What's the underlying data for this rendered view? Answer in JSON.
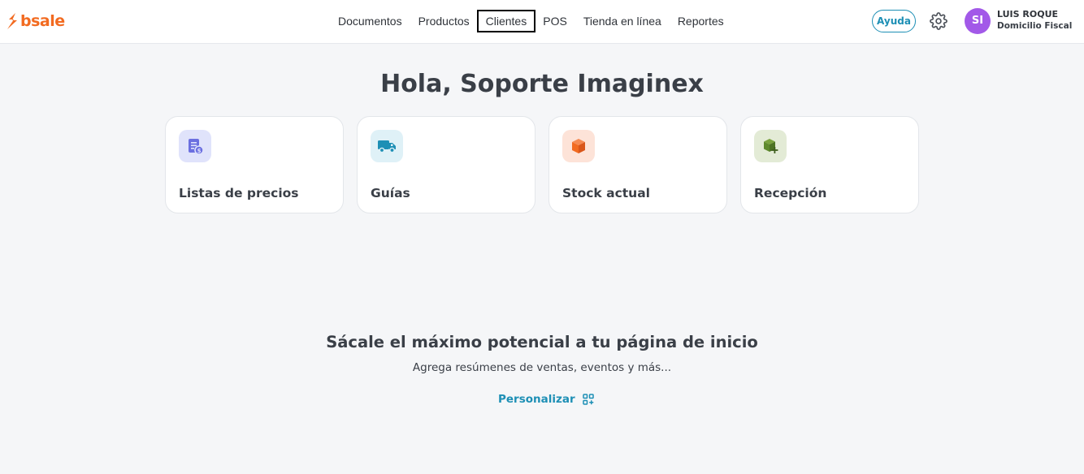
{
  "brand": {
    "name": "bsale",
    "color": "#f26b21"
  },
  "nav": {
    "items": [
      {
        "label": "Documentos"
      },
      {
        "label": "Productos"
      },
      {
        "label": "Clientes"
      },
      {
        "label": "POS"
      },
      {
        "label": "Tienda en línea"
      },
      {
        "label": "Reportes"
      }
    ]
  },
  "header": {
    "help_label": "Ayuda",
    "settings_icon": "gear-icon",
    "user": {
      "initials": "SI",
      "name": "LUIS ROQUE",
      "branch": "Domicilio Fiscal",
      "avatar_color": "#a259e8"
    }
  },
  "main": {
    "greeting": "Hola, Soporte Imaginex",
    "shortcuts": [
      {
        "label": "Listas de precios",
        "icon": "price-list-icon",
        "icon_bg": "#e0e3fb",
        "icon_color": "#6b6fe0"
      },
      {
        "label": "Guías",
        "icon": "delivery-truck-icon",
        "icon_bg": "#dff1f7",
        "icon_color": "#1d8fb5"
      },
      {
        "label": "Stock actual",
        "icon": "box-icon",
        "icon_bg": "#fde3d8",
        "icon_color": "#f26b21"
      },
      {
        "label": "Recepción",
        "icon": "box-add-icon",
        "icon_bg": "#e3ebd6",
        "icon_color": "#5f8a2e"
      }
    ],
    "promo": {
      "title": "Sácale el máximo potencial a tu página de inicio",
      "subtitle": "Agrega resúmenes de ventas, eventos y más...",
      "action_label": "Personalizar",
      "action_icon": "grid-add-icon"
    }
  }
}
